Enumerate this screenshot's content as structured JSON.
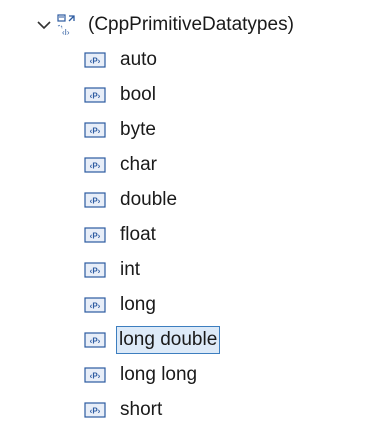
{
  "tree": {
    "root": {
      "label": "(CppPrimitiveDatatypes)",
      "expanded": true,
      "icon": "package-icon"
    },
    "children": [
      {
        "label": "auto",
        "icon": "primitive-type-icon"
      },
      {
        "label": "bool",
        "icon": "primitive-type-icon"
      },
      {
        "label": "byte",
        "icon": "primitive-type-icon"
      },
      {
        "label": "char",
        "icon": "primitive-type-icon"
      },
      {
        "label": "double",
        "icon": "primitive-type-icon"
      },
      {
        "label": "float",
        "icon": "primitive-type-icon"
      },
      {
        "label": "int",
        "icon": "primitive-type-icon"
      },
      {
        "label": "long",
        "icon": "primitive-type-icon"
      },
      {
        "label": "long double",
        "icon": "primitive-type-icon",
        "selected": true
      },
      {
        "label": "long long",
        "icon": "primitive-type-icon"
      },
      {
        "label": "short",
        "icon": "primitive-type-icon"
      }
    ]
  },
  "colors": {
    "selection_border": "#3d7ebf",
    "selection_fill": "#ddeaf8",
    "icon_blue": "#2c5aa0",
    "icon_fill": "#e8eef8"
  }
}
